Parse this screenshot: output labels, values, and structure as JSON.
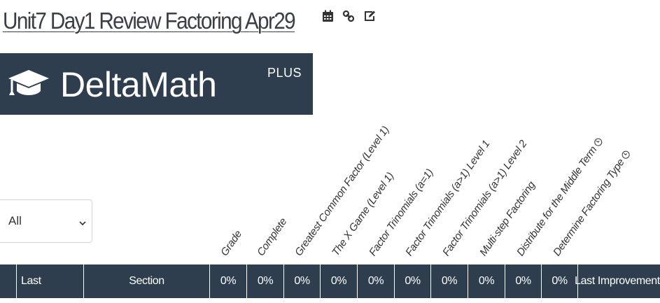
{
  "header": {
    "title": "Unit7 Day1 Review Factoring Apr29",
    "icons": [
      "calendar-icon",
      "link-icon",
      "edit-icon"
    ]
  },
  "logo": {
    "text": "DeltaMath",
    "superscript": "PLUS"
  },
  "filter": {
    "selected": "All"
  },
  "columns": [
    "Grade",
    "Complete",
    "Greatest Common Factor (Level 1)",
    "The X Game (Level 1)",
    "Factor Trinomials (a=1)",
    "Factor Trinomials (a>1) Level 1",
    "Factor Trinomials (a>1) Level 2",
    "Multi-step Factoring",
    "Distribute for the Middle Term",
    "Determine Factoring Type"
  ],
  "table": {
    "last_label": "Last",
    "section_label": "Section",
    "percentages": [
      "0%",
      "0%",
      "0%",
      "0%",
      "0%",
      "0%",
      "0%",
      "0%",
      "0%",
      "0%"
    ],
    "last_improvement_label": "Last Improvement"
  },
  "colors": {
    "header_bg": "#2e3e4e",
    "title_text": "#3a3f45"
  }
}
